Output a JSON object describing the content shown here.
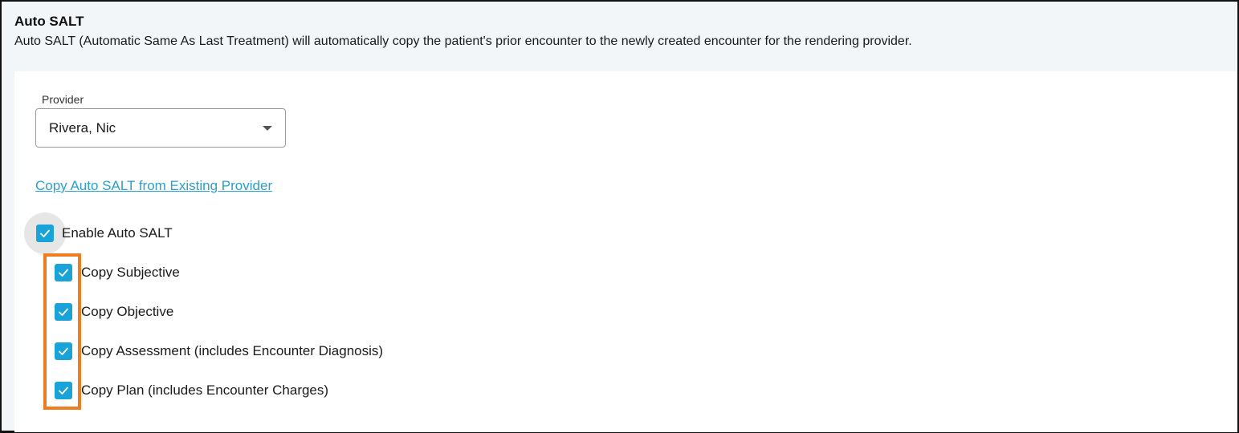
{
  "header": {
    "title": "Auto SALT",
    "description": "Auto SALT (Automatic Same As Last Treatment) will automatically copy the patient's prior encounter to the newly created encounter for the rendering provider."
  },
  "provider": {
    "label": "Provider",
    "selected": "Rivera, Nic",
    "icon": "chevron-down-icon"
  },
  "copy_link": {
    "label": "Copy Auto SALT from Existing Provider"
  },
  "enable": {
    "label": "Enable Auto SALT",
    "checked": true
  },
  "options": [
    {
      "label": "Copy Subjective",
      "checked": true
    },
    {
      "label": "Copy Objective",
      "checked": true
    },
    {
      "label": "Copy Assessment (includes Encounter Diagnosis)",
      "checked": true
    },
    {
      "label": "Copy Plan (includes Encounter Charges)",
      "checked": true
    }
  ],
  "colors": {
    "checkbox": "#1aa3d9",
    "link": "#2a9fd0",
    "highlight": "#f07c22",
    "header_bg": "#f2f6f9"
  }
}
